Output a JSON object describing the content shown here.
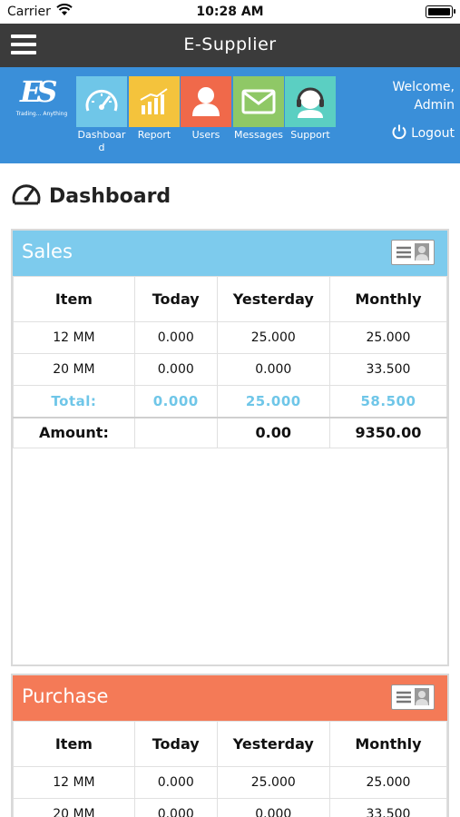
{
  "status_bar": {
    "carrier": "Carrier",
    "time": "10:28 AM"
  },
  "topbar": {
    "title": "E-Supplier"
  },
  "header": {
    "logo_text": "ES",
    "logo_tagline": "Trading... Anything",
    "nav": [
      {
        "label": "Dashboard",
        "icon": "speedometer-icon",
        "color": "#6fc6e8"
      },
      {
        "label": "Report",
        "icon": "bar-chart-icon",
        "color": "#f4c33c"
      },
      {
        "label": "Users",
        "icon": "user-icon",
        "color": "#f0694a"
      },
      {
        "label": "Messages",
        "icon": "envelope-icon",
        "color": "#8fc866"
      },
      {
        "label": "Support",
        "icon": "headset-icon",
        "color": "#5bcfc2"
      }
    ],
    "welcome_line1": "Welcome,",
    "welcome_line2": "Admin",
    "logout": "Logout"
  },
  "page": {
    "title": "Dashboard"
  },
  "sales": {
    "title": "Sales",
    "columns": [
      "Item",
      "Today",
      "Yesterday",
      "Monthly"
    ],
    "rows": [
      [
        "12 MM",
        "0.000",
        "25.000",
        "25.000"
      ],
      [
        "20 MM",
        "0.000",
        "0.000",
        "33.500"
      ]
    ],
    "total": [
      "Total:",
      "0.000",
      "25.000",
      "58.500"
    ],
    "amount": [
      "Amount:",
      "",
      "0.00",
      "9350.00"
    ]
  },
  "purchase": {
    "title": "Purchase",
    "columns": [
      "Item",
      "Today",
      "Yesterday",
      "Monthly"
    ],
    "rows": [
      [
        "12 MM",
        "0.000",
        "25.000",
        "25.000"
      ],
      [
        "20 MM",
        "0.000",
        "0.000",
        "33.500"
      ]
    ]
  }
}
